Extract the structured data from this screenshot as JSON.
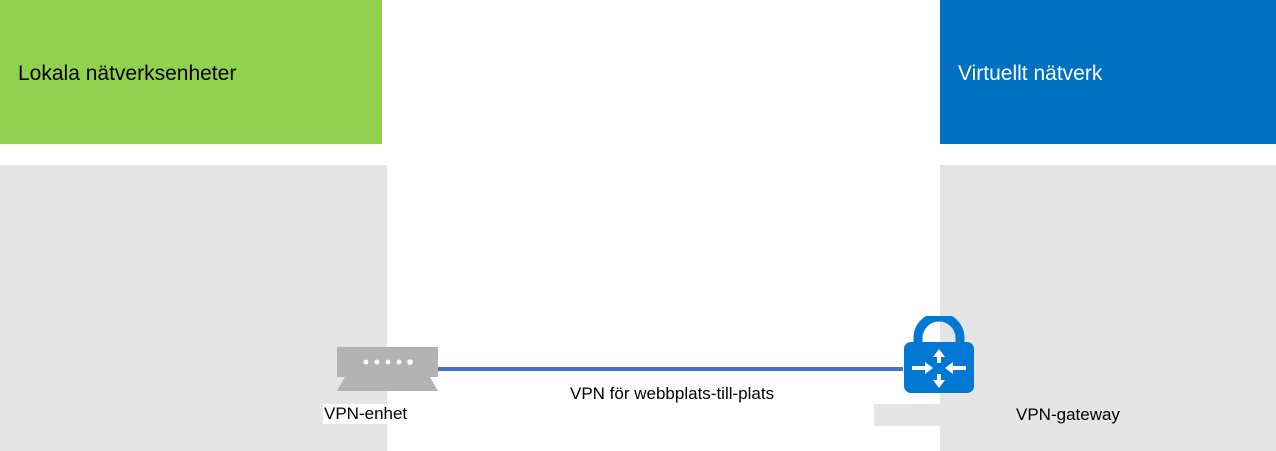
{
  "left_panel": {
    "title": "Lokala nätverksenheter",
    "color": "#92d050"
  },
  "right_panel": {
    "title": "Virtuellt nätverk",
    "color": "#0070c0"
  },
  "area_color": "#e5e5e5",
  "connection": {
    "label": "VPN för webbplats-till-plats",
    "color": "#4472c4"
  },
  "vpn_device": {
    "label": "VPN-enhet",
    "icon": "network-device-icon"
  },
  "vpn_gateway": {
    "label": "VPN-gateway",
    "icon": "vpn-gateway-lock-icon"
  }
}
